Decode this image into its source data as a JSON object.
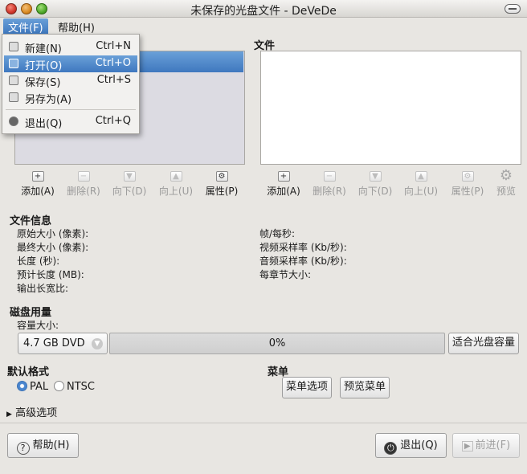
{
  "window": {
    "title": "未保存的光盘文件 - DeVeDe"
  },
  "menubar": {
    "file": "文件(F)",
    "help": "帮助(H)"
  },
  "file_menu": {
    "items": [
      {
        "label": "新建(N)",
        "accel": "Ctrl+N",
        "icon": "new-document-icon"
      },
      {
        "label": "打开(O)",
        "accel": "Ctrl+O",
        "icon": "open-folder-icon",
        "highlighted": true
      },
      {
        "label": "保存(S)",
        "accel": "Ctrl+S",
        "icon": "save-icon"
      },
      {
        "label": "另存为(A)",
        "accel": "",
        "icon": "save-as-icon"
      },
      {
        "label": "退出(Q)",
        "accel": "Ctrl+Q",
        "icon": "quit-icon"
      }
    ]
  },
  "files_panel": {
    "title": "文件"
  },
  "left_toolbar": {
    "add": "添加(A)",
    "delete": "删除(R)",
    "down": "向下(D)",
    "up": "向上(U)",
    "properties": "属性(P)"
  },
  "right_toolbar": {
    "add": "添加(A)",
    "delete": "删除(R)",
    "down": "向下(D)",
    "up": "向上(U)",
    "properties": "属性(P)",
    "preview": "预览"
  },
  "file_info": {
    "title": "文件信息",
    "original_size": "原始大小 (像素):",
    "final_size": "最终大小 (像素):",
    "length": "长度 (秒):",
    "estimated_length": "预计长度 (MB):",
    "aspect": "输出长宽比:",
    "fps": "帧/每秒:",
    "video_rate": "视频采样率 (Kb/秒):",
    "audio_rate": "音频采样率 (Kb/秒):",
    "chapter_size": "每章节大小:"
  },
  "disk_usage": {
    "title": "磁盘用量",
    "capacity_label": "容量大小:",
    "capacity_value": "4.7 GB DVD",
    "usage_text": "0%",
    "usage_fraction": 0,
    "fit_button": "适合光盘容量"
  },
  "default_format": {
    "title": "默认格式",
    "pal": "PAL",
    "ntsc": "NTSC",
    "selected": "PAL"
  },
  "menu_section": {
    "title": "菜单",
    "options_button": "菜单选项",
    "preview_button": "预览菜单"
  },
  "advanced": {
    "label": "高级选项"
  },
  "bottom": {
    "help": "帮助(H)",
    "quit": "退出(Q)",
    "forward": "前进(F)"
  }
}
